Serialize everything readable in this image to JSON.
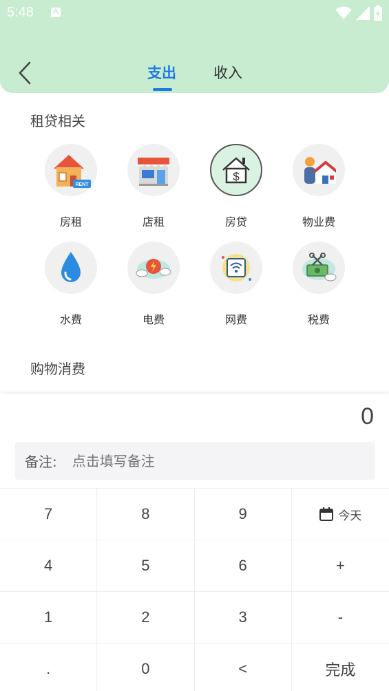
{
  "status_bar": {
    "time": "5:48"
  },
  "header": {
    "tabs": [
      {
        "label": "支出",
        "active": true
      },
      {
        "label": "收入",
        "active": false
      }
    ]
  },
  "sections": [
    {
      "title": "租贷相关",
      "items": [
        {
          "label": "房租",
          "icon": "house-rent-icon"
        },
        {
          "label": "店租",
          "icon": "store-icon"
        },
        {
          "label": "房贷",
          "icon": "house-dollar-icon",
          "selected": true
        },
        {
          "label": "物业费",
          "icon": "property-icon"
        },
        {
          "label": "水费",
          "icon": "water-drop-icon"
        },
        {
          "label": "电费",
          "icon": "electricity-icon"
        },
        {
          "label": "网费",
          "icon": "wifi-icon"
        },
        {
          "label": "税费",
          "icon": "tax-money-icon"
        }
      ]
    },
    {
      "title": "购物消费"
    }
  ],
  "keypad": {
    "amount": "0",
    "note_label": "备注:",
    "note_placeholder": "点击填写备注",
    "keys": [
      "7",
      "8",
      "9",
      "今天",
      "4",
      "5",
      "6",
      "+",
      "1",
      "2",
      "3",
      "-",
      ".",
      "0",
      "<",
      "完成"
    ]
  },
  "colors": {
    "header_bg": "#c7ecd0",
    "accent": "#1e7be0"
  }
}
